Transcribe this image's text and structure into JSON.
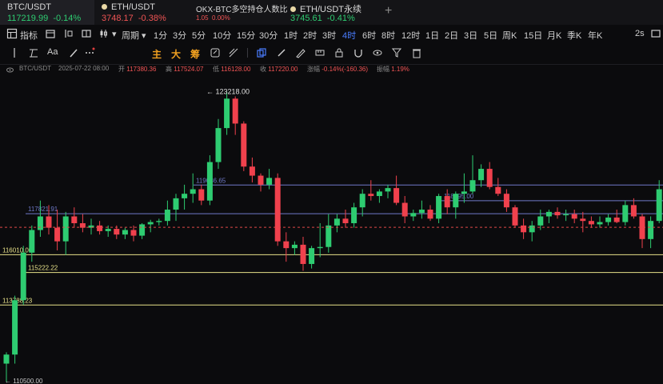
{
  "tabs": [
    {
      "symbol": "BTC/USDT",
      "price": "117219.99",
      "change": "-0.14%",
      "price_color": "#2ecc71",
      "change_color": "#2ecc71",
      "active": true
    },
    {
      "symbol": "ETH/USDT",
      "price": "3748.17",
      "change": "-0.38%",
      "price_color": "#f05454",
      "change_color": "#f05454",
      "active": false
    },
    {
      "symbol": "OKX-BTC多空持仓人数比",
      "price": "1.05",
      "change": "0.00%",
      "price_color": "#f05454",
      "change_color": "#f05454",
      "active": false
    },
    {
      "symbol": "ETH/USDT永续",
      "price": "3745.61",
      "change": "-0.41%",
      "price_color": "#2ecc71",
      "change_color": "#2ecc71",
      "active": false
    }
  ],
  "toolbar": {
    "indicator_label": "指标",
    "period_label": "周期",
    "periods": [
      "1分",
      "3分",
      "5分",
      "10分",
      "15分",
      "30分",
      "1时",
      "2时",
      "3时",
      "4时",
      "6时",
      "8时",
      "12时",
      "1日",
      "2日",
      "3日",
      "5日",
      "周K",
      "15日",
      "月K",
      "季K",
      "年K"
    ],
    "active_period": "4时",
    "refresh_label": "2s"
  },
  "drawtools": {
    "text_a": "Aa",
    "main_label": "主",
    "big_label": "大",
    "chip_label": "筹"
  },
  "ohlc": {
    "symbol": "BTC/USDT",
    "time": "2025-07-22 08:00",
    "open_label": "开",
    "open": "117380.36",
    "high_label": "高",
    "high": "117524.07",
    "low_label": "低",
    "low": "116128.00",
    "close_label": "收",
    "close": "117220.00",
    "change_label": "涨幅",
    "change": "-0.14%(-160.36)",
    "amp_label": "振幅",
    "amp": "1.19%"
  },
  "chart_data": {
    "type": "candlestick",
    "up_color": "#2ecc71",
    "down_color": "#f0414d",
    "candles": [
      {
        "o": 111200,
        "h": 111700,
        "l": 110400,
        "c": 111600
      },
      {
        "o": 111600,
        "h": 114200,
        "l": 111200,
        "c": 114000
      },
      {
        "o": 114000,
        "h": 116400,
        "l": 113800,
        "c": 116100
      },
      {
        "o": 116100,
        "h": 117300,
        "l": 115700,
        "c": 117100
      },
      {
        "o": 117100,
        "h": 118400,
        "l": 116800,
        "c": 117700
      },
      {
        "o": 117700,
        "h": 118200,
        "l": 116900,
        "c": 117200
      },
      {
        "o": 117200,
        "h": 118000,
        "l": 116200,
        "c": 116600
      },
      {
        "o": 116600,
        "h": 117900,
        "l": 116000,
        "c": 117700
      },
      {
        "o": 117700,
        "h": 118100,
        "l": 117200,
        "c": 117400
      },
      {
        "o": 117400,
        "h": 117800,
        "l": 117000,
        "c": 117200
      },
      {
        "o": 117200,
        "h": 117600,
        "l": 116900,
        "c": 117300
      },
      {
        "o": 117300,
        "h": 117500,
        "l": 116900,
        "c": 117050
      },
      {
        "o": 117050,
        "h": 117300,
        "l": 116800,
        "c": 117150
      },
      {
        "o": 117150,
        "h": 117300,
        "l": 116700,
        "c": 116900
      },
      {
        "o": 116900,
        "h": 117200,
        "l": 116700,
        "c": 117100
      },
      {
        "o": 117100,
        "h": 117300,
        "l": 116600,
        "c": 116850
      },
      {
        "o": 116850,
        "h": 117400,
        "l": 116700,
        "c": 117350
      },
      {
        "o": 117350,
        "h": 117550,
        "l": 117000,
        "c": 117450
      },
      {
        "o": 117450,
        "h": 117600,
        "l": 117300,
        "c": 117500
      },
      {
        "o": 117500,
        "h": 118400,
        "l": 117300,
        "c": 118000
      },
      {
        "o": 118000,
        "h": 118700,
        "l": 117500,
        "c": 118500
      },
      {
        "o": 118500,
        "h": 119100,
        "l": 118000,
        "c": 118700
      },
      {
        "o": 118700,
        "h": 119600,
        "l": 118300,
        "c": 118900
      },
      {
        "o": 118900,
        "h": 119100,
        "l": 118200,
        "c": 118400
      },
      {
        "o": 118400,
        "h": 120400,
        "l": 118200,
        "c": 120100
      },
      {
        "o": 120100,
        "h": 122000,
        "l": 119800,
        "c": 121600
      },
      {
        "o": 121600,
        "h": 123218,
        "l": 121300,
        "c": 122900
      },
      {
        "o": 122900,
        "h": 123000,
        "l": 121300,
        "c": 121800
      },
      {
        "o": 121800,
        "h": 121900,
        "l": 119700,
        "c": 119900
      },
      {
        "o": 119900,
        "h": 120300,
        "l": 119200,
        "c": 119500
      },
      {
        "o": 119500,
        "h": 119600,
        "l": 118800,
        "c": 119100
      },
      {
        "o": 119100,
        "h": 119800,
        "l": 118900,
        "c": 119400
      },
      {
        "o": 119400,
        "h": 119600,
        "l": 116400,
        "c": 116600
      },
      {
        "o": 116600,
        "h": 117000,
        "l": 115700,
        "c": 116300
      },
      {
        "o": 116300,
        "h": 116600,
        "l": 116000,
        "c": 116450
      },
      {
        "o": 116450,
        "h": 116800,
        "l": 115300,
        "c": 115600
      },
      {
        "o": 115600,
        "h": 116400,
        "l": 115400,
        "c": 116300
      },
      {
        "o": 116300,
        "h": 117400,
        "l": 115900,
        "c": 116350
      },
      {
        "o": 116350,
        "h": 117800,
        "l": 116100,
        "c": 117300
      },
      {
        "o": 117300,
        "h": 117800,
        "l": 117000,
        "c": 117600
      },
      {
        "o": 117600,
        "h": 118000,
        "l": 117200,
        "c": 117400
      },
      {
        "o": 117400,
        "h": 118300,
        "l": 117200,
        "c": 118100
      },
      {
        "o": 118100,
        "h": 118900,
        "l": 117700,
        "c": 118700
      },
      {
        "o": 118700,
        "h": 119300,
        "l": 118400,
        "c": 118600
      },
      {
        "o": 118600,
        "h": 118900,
        "l": 118300,
        "c": 118800
      },
      {
        "o": 118800,
        "h": 119100,
        "l": 118500,
        "c": 118950
      },
      {
        "o": 118950,
        "h": 119500,
        "l": 118200,
        "c": 118300
      },
      {
        "o": 118300,
        "h": 118600,
        "l": 117400,
        "c": 117700
      },
      {
        "o": 117700,
        "h": 118000,
        "l": 117500,
        "c": 117850
      },
      {
        "o": 117850,
        "h": 118400,
        "l": 117600,
        "c": 118000
      },
      {
        "o": 118000,
        "h": 118200,
        "l": 117500,
        "c": 117600
      },
      {
        "o": 117600,
        "h": 118700,
        "l": 117400,
        "c": 118600
      },
      {
        "o": 118600,
        "h": 118900,
        "l": 117800,
        "c": 118100
      },
      {
        "o": 118100,
        "h": 118800,
        "l": 117600,
        "c": 118700
      },
      {
        "o": 118700,
        "h": 119600,
        "l": 118300,
        "c": 118800
      },
      {
        "o": 118800,
        "h": 120400,
        "l": 118700,
        "c": 119300
      },
      {
        "o": 119300,
        "h": 120000,
        "l": 119000,
        "c": 119800
      },
      {
        "o": 119800,
        "h": 120100,
        "l": 118900,
        "c": 119000
      },
      {
        "o": 119000,
        "h": 119400,
        "l": 118600,
        "c": 118700
      },
      {
        "o": 118700,
        "h": 118900,
        "l": 117900,
        "c": 118100
      },
      {
        "o": 118100,
        "h": 118200,
        "l": 117200,
        "c": 117300
      },
      {
        "o": 117300,
        "h": 117600,
        "l": 116700,
        "c": 117000
      },
      {
        "o": 117000,
        "h": 117500,
        "l": 116600,
        "c": 117300
      },
      {
        "o": 117300,
        "h": 118000,
        "l": 117100,
        "c": 117700
      },
      {
        "o": 117700,
        "h": 118000,
        "l": 117400,
        "c": 117900
      },
      {
        "o": 117900,
        "h": 118100,
        "l": 117600,
        "c": 117750
      },
      {
        "o": 117750,
        "h": 118000,
        "l": 117500,
        "c": 117800
      },
      {
        "o": 117800,
        "h": 118000,
        "l": 117400,
        "c": 117600
      },
      {
        "o": 117600,
        "h": 117900,
        "l": 117000,
        "c": 117500
      },
      {
        "o": 117500,
        "h": 117700,
        "l": 117200,
        "c": 117350
      },
      {
        "o": 117350,
        "h": 117700,
        "l": 117200,
        "c": 117450
      },
      {
        "o": 117450,
        "h": 117800,
        "l": 117300,
        "c": 117650
      },
      {
        "o": 117650,
        "h": 118000,
        "l": 117400,
        "c": 117450
      },
      {
        "o": 117450,
        "h": 118400,
        "l": 117300,
        "c": 118200
      },
      {
        "o": 118200,
        "h": 118500,
        "l": 117600,
        "c": 117700
      },
      {
        "o": 117700,
        "h": 117800,
        "l": 116300,
        "c": 116700
      },
      {
        "o": 116700,
        "h": 117700,
        "l": 116300,
        "c": 117500
      },
      {
        "o": 117500,
        "h": 119300,
        "l": 117400,
        "c": 118900
      },
      {
        "o": 118900,
        "h": 119100,
        "l": 117500,
        "c": 117800
      },
      {
        "o": 117800,
        "h": 118600,
        "l": 117500,
        "c": 117600
      },
      {
        "o": 117600,
        "h": 117700,
        "l": 115900,
        "c": 116300
      },
      {
        "o": 116300,
        "h": 117100,
        "l": 116100,
        "c": 117000
      },
      {
        "o": 117380,
        "h": 117524,
        "l": 116128,
        "c": 117220
      }
    ],
    "horizontal_lines": [
      {
        "price": 119086.65,
        "label": "119086.65",
        "color": "#6f79c8"
      },
      {
        "price": 118395.0,
        "label": "118395.00",
        "color": "#6f79c8"
      },
      {
        "price": 117821.91,
        "label": "117821.91",
        "color": "#6f79c8"
      },
      {
        "price": 116010.0,
        "label": "116010.00",
        "color": "#e8e28a"
      },
      {
        "price": 115222.22,
        "label": "115222.22",
        "color": "#e8e28a"
      },
      {
        "price": 113788.23,
        "label": "113788.23",
        "color": "#e8e28a"
      }
    ],
    "current_price": 117220.0,
    "high_marker": {
      "price": 123218.0,
      "label": "123218.00"
    },
    "bottom_label": "110500.00",
    "ylim": [
      110300,
      123900
    ]
  }
}
